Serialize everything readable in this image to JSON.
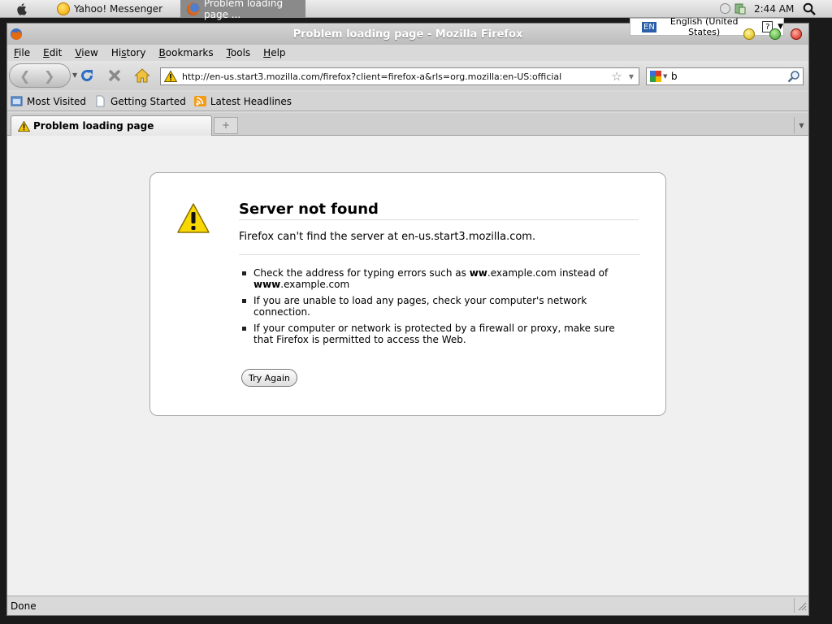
{
  "taskbar": {
    "items": [
      {
        "label": "Yahoo! Messenger"
      },
      {
        "label": "Problem loading page ..."
      }
    ],
    "clock": "2:44 AM"
  },
  "language_bar": {
    "code": "EN",
    "label": "English (United States)",
    "help": "?"
  },
  "window": {
    "title": "Problem loading page - Mozilla Firefox"
  },
  "menubar": {
    "items": [
      {
        "mnemonic": "F",
        "rest": "ile"
      },
      {
        "mnemonic": "E",
        "rest": "dit"
      },
      {
        "mnemonic": "V",
        "rest": "iew"
      },
      {
        "pre": "Hi",
        "mnemonic": "s",
        "rest": "tory"
      },
      {
        "mnemonic": "B",
        "rest": "ookmarks"
      },
      {
        "mnemonic": "T",
        "rest": "ools"
      },
      {
        "mnemonic": "H",
        "rest": "elp"
      }
    ]
  },
  "navbar": {
    "url": "http://en-us.start3.mozilla.com/firefox?client=firefox-a&rls=org.mozilla:en-US:official",
    "search_value": "b"
  },
  "bookmarks": {
    "items": [
      {
        "label": "Most Visited"
      },
      {
        "label": "Getting Started"
      },
      {
        "label": "Latest Headlines"
      }
    ]
  },
  "tabs": {
    "active_label": "Problem loading page",
    "new_tab": "+"
  },
  "error": {
    "title": "Server not found",
    "description": "Firefox can't find the server at en-us.start3.mozilla.com.",
    "bullet1": {
      "a": "Check the address for typing errors such as ",
      "b": "ww",
      "c": ".example.com instead of ",
      "d": "www",
      "e": ".example.com"
    },
    "bullet2": "If you are unable to load any pages, check your computer's network connection.",
    "bullet3": "If your computer or network is protected by a firewall or proxy, make sure that Firefox is permitted to access the Web.",
    "button": "Try Again"
  },
  "status": {
    "text": "Done"
  },
  "icons": {
    "apple": "apple-icon",
    "yahoo": "yahoo-smiley-icon",
    "firefox": "firefox-icon",
    "warning": "warning-icon",
    "reload": "reload-icon",
    "stop": "stop-icon",
    "home": "home-icon",
    "search": "magnifier-icon",
    "google": "google-icon",
    "rss": "rss-icon"
  }
}
